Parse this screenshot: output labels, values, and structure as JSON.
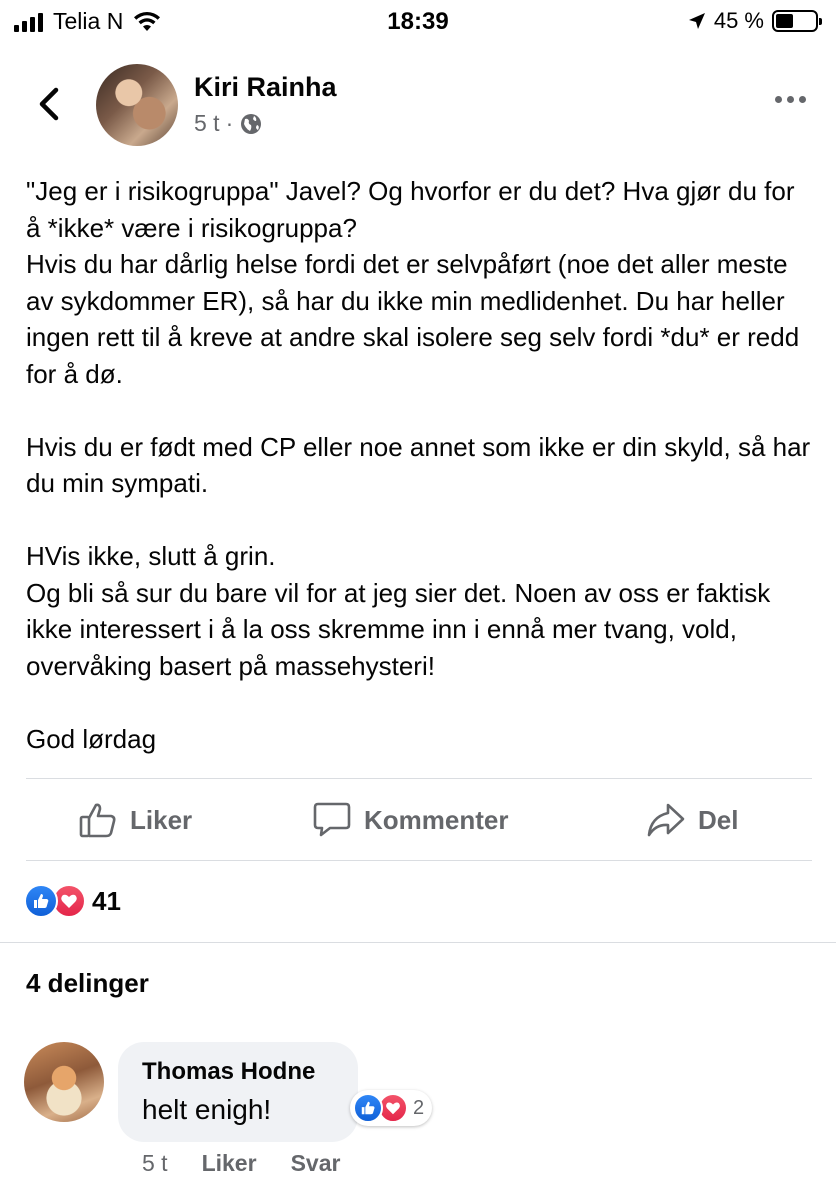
{
  "status_bar": {
    "carrier": "Telia N",
    "time": "18:39",
    "battery_percent": "45 %",
    "battery_level": 0.45
  },
  "post": {
    "author": "Kiri Rainha",
    "timestamp": "5 t",
    "separator": "·",
    "privacy_icon": "globe-icon",
    "text": "\"Jeg er i risikogruppa\"  Javel? Og hvorfor er du det? Hva gjør du for å *ikke* være i risikogruppa?\nHvis du har dårlig helse fordi det er selvpåført (noe det aller meste av sykdommer ER), så har du ikke min medlidenhet. Du har heller ingen rett til å kreve at andre skal isolere seg selv fordi *du* er redd for å dø.\n\nHvis du er født med CP eller noe annet som ikke er din skyld, så har du min sympati.\n\nHVis ikke, slutt å grin.\nOg bli så sur du bare vil for at jeg sier det. Noen av oss er faktisk ikke interessert i å la oss skremme inn i ennå mer tvang, vold, overvåking basert på  massehysteri!\n\nGod lørdag"
  },
  "actions": {
    "like": "Liker",
    "comment": "Kommenter",
    "share": "Del"
  },
  "reactions": {
    "count": "41",
    "types": [
      "like",
      "love"
    ]
  },
  "shares": "4 delinger",
  "comment": {
    "author": "Thomas Hodne",
    "text": "helt enigh!",
    "reaction_count": "2",
    "timestamp": "5 t",
    "like": "Liker",
    "reply": "Svar"
  },
  "colors": {
    "like_blue": "#1877f2",
    "love_red": "#f02849",
    "secondary_text": "#65676b",
    "bubble_bg": "#f0f2f5"
  }
}
